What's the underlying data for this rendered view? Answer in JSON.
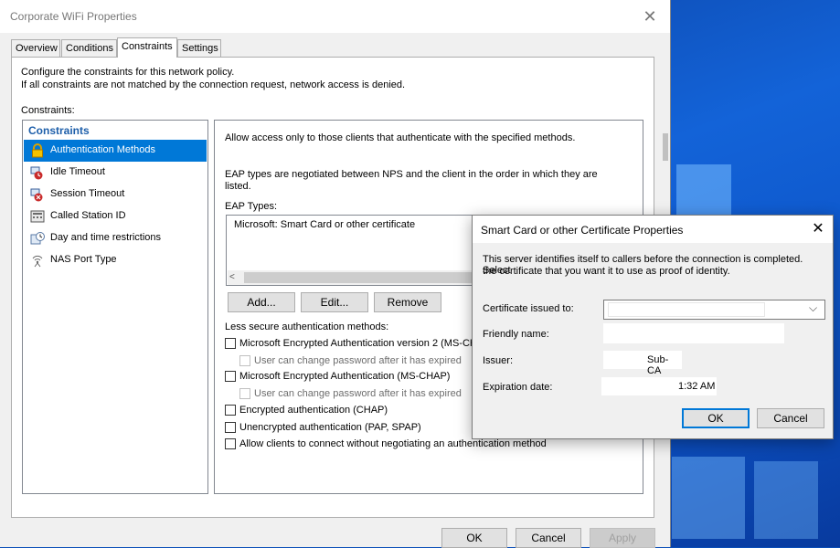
{
  "window": {
    "title": "Corporate WiFi Properties",
    "tabs": [
      {
        "label": "Overview"
      },
      {
        "label": "Conditions"
      },
      {
        "label": "Constraints"
      },
      {
        "label": "Settings"
      }
    ],
    "active_tab": "Constraints"
  },
  "constraints_page": {
    "description_line1": "Configure the constraints for this network policy.",
    "description_line2": "If all constraints are not matched by the connection request, network access is denied.",
    "constraints_label": "Constraints:",
    "tree_header": "Constraints",
    "tree_items": [
      {
        "label": "Authentication Methods",
        "icon": "lock-icon",
        "selected": true
      },
      {
        "label": "Idle Timeout",
        "icon": "idle-timeout-icon",
        "selected": false
      },
      {
        "label": "Session Timeout",
        "icon": "session-timeout-icon",
        "selected": false
      },
      {
        "label": "Called Station ID",
        "icon": "called-station-icon",
        "selected": false
      },
      {
        "label": "Day and time restrictions",
        "icon": "clock-icon",
        "selected": false
      },
      {
        "label": "NAS Port Type",
        "icon": "nas-port-icon",
        "selected": false
      }
    ],
    "detail": {
      "intro": "Allow access only to those clients that authenticate with the specified methods.",
      "eap_note_line1": "EAP types are negotiated between NPS and the client in the order in which they are",
      "eap_note_line2": "listed.",
      "eap_types_label": "EAP Types:",
      "eap_types": [
        "Microsoft: Smart Card or other certificate"
      ],
      "add_button": "Add...",
      "edit_button": "Edit...",
      "remove_button": "Remove",
      "less_secure_label": "Less secure authentication methods:",
      "methods": [
        {
          "label": "Microsoft Encrypted Authentication version 2 (MS-CHAP",
          "checked": false,
          "disabled": false,
          "indent": false
        },
        {
          "label": "User can change password after it has expired",
          "checked": false,
          "disabled": true,
          "indent": true
        },
        {
          "label": "Microsoft Encrypted Authentication (MS-CHAP)",
          "checked": false,
          "disabled": false,
          "indent": false
        },
        {
          "label": "User can change password after it has expired",
          "checked": false,
          "disabled": true,
          "indent": true
        },
        {
          "label": "Encrypted authentication (CHAP)",
          "checked": false,
          "disabled": false,
          "indent": false
        },
        {
          "label": "Unencrypted authentication (PAP, SPAP)",
          "checked": false,
          "disabled": false,
          "indent": false
        },
        {
          "label": "Allow clients to connect without negotiating an authentication method",
          "checked": false,
          "disabled": false,
          "indent": false
        }
      ]
    }
  },
  "footer": {
    "ok": "OK",
    "cancel": "Cancel",
    "apply": "Apply"
  },
  "cert_dialog": {
    "title": "Smart Card or other Certificate Properties",
    "description_line1": "This server identifies itself to callers before the connection is completed. Select",
    "description_line2": "the certificate that you want it to use as proof of identity.",
    "cert_issued_label": "Certificate issued to:",
    "cert_issued_value": "",
    "friendly_name_label": "Friendly name:",
    "friendly_name_value": "",
    "issuer_label": "Issuer:",
    "issuer_value": "Sub-CA",
    "expiration_label": "Expiration date:",
    "expiration_value": "1:32 AM",
    "ok": "OK",
    "cancel": "Cancel"
  },
  "colors": {
    "selection": "#0078d7",
    "header_blue": "#1e5faa",
    "desktop_blue": "#0b4fb8"
  }
}
